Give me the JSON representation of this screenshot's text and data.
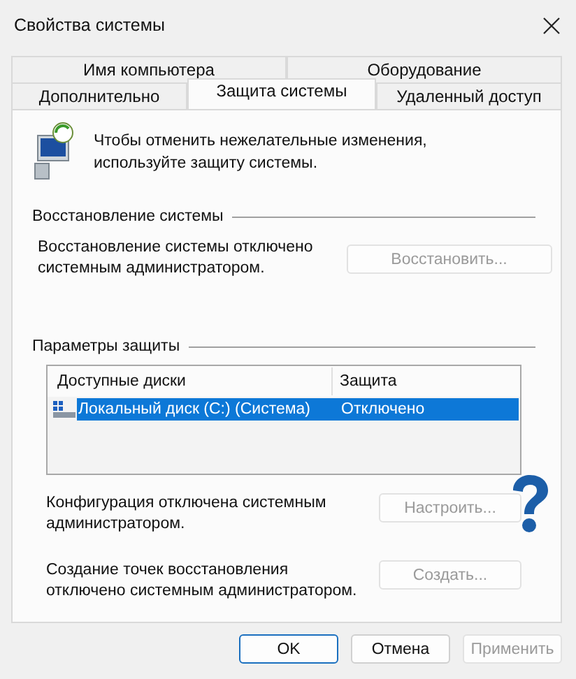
{
  "window": {
    "title": "Свойства системы"
  },
  "tab_rows": [
    [
      {
        "label": "Имя компьютера",
        "selected": false
      },
      {
        "label": "Оборудование",
        "selected": false
      }
    ],
    [
      {
        "label": "Дополнительно",
        "selected": false
      },
      {
        "label": "Защита системы",
        "selected": true
      },
      {
        "label": "Удаленный доступ",
        "selected": false
      }
    ]
  ],
  "intro": "Чтобы отменить нежелательные изменения, используйте защиту системы.",
  "restore": {
    "heading": "Восстановление системы",
    "text": "Восстановление системы отключено системным администратором.",
    "button": {
      "label": "Восстановить...",
      "disabled": true
    }
  },
  "protection": {
    "heading": "Параметры защиты",
    "columns": [
      "Доступные диски",
      "Защита"
    ],
    "rows": [
      {
        "drive": "Локальный диск (C:) (Система)",
        "protection": "Отключено",
        "selected": true
      }
    ],
    "items": [
      {
        "text": "Конфигурация отключена системным администратором.",
        "button": {
          "label": "Настроить...",
          "disabled": true
        }
      },
      {
        "text": "Создание точек восстановления отключено системным администратором.",
        "button": {
          "label": "Создать...",
          "disabled": true
        }
      }
    ]
  },
  "buttons": [
    {
      "label": "OK",
      "default": true,
      "disabled": false
    },
    {
      "label": "Отмена",
      "default": false,
      "disabled": false
    },
    {
      "label": "Применить",
      "default": false,
      "disabled": true
    }
  ]
}
